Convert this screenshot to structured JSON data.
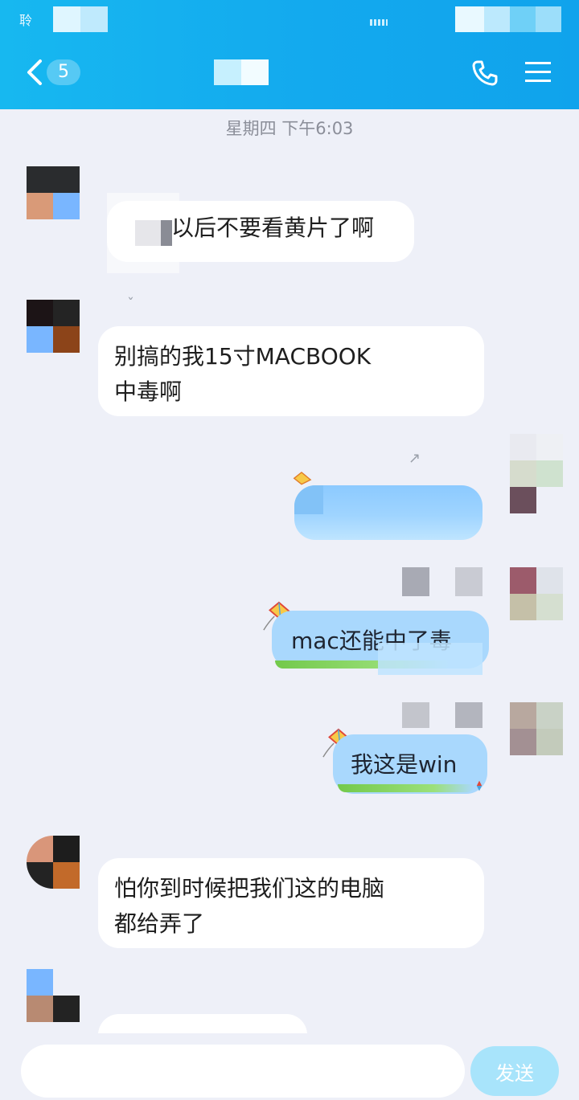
{
  "status_bar": {
    "left_text": "聆"
  },
  "header": {
    "unread_count": "5",
    "back_icon": "chevron-left-icon",
    "call_icon": "phone-icon",
    "menu_icon": "hamburger-menu-icon",
    "accent": "#13a9ee"
  },
  "chat": {
    "timestamp": "星期四 下午6:03",
    "messages": [
      {
        "side": "left",
        "text": "以后不要看黄片了啊"
      },
      {
        "side": "left",
        "text_line1": "别搞的我15寸MACBOOK",
        "text_line2": "中毒啊"
      },
      {
        "side": "right",
        "text": ""
      },
      {
        "side": "right",
        "text": "mac还能中了毒"
      },
      {
        "side": "right",
        "text": "我这是win"
      },
      {
        "side": "left",
        "text_line1": "怕你到时候把我们这的电脑",
        "text_line2": "都给弄了"
      },
      {
        "side": "left",
        "text": ""
      }
    ]
  },
  "composer": {
    "placeholder": "",
    "send_label": "发送"
  }
}
